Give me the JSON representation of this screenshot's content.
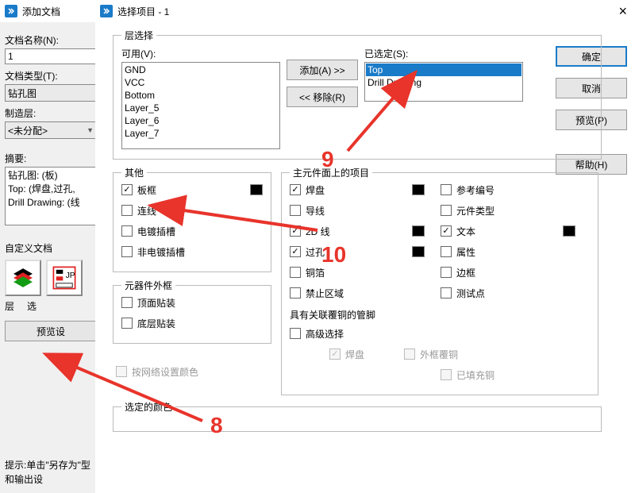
{
  "add_dialog": {
    "title": "添加文档",
    "doc_name_label": "文档名称(N):",
    "doc_name_value": "1",
    "doc_type_label": "文档类型(T):",
    "doc_type_value": "钻孔图",
    "mfg_layer_label": "制造层:",
    "mfg_layer_value": "<未分配>",
    "summary_label": "摘要:",
    "summary_lines": [
      "钻孔图: (板)",
      "Top: (焊盘,过孔,",
      "Drill Drawing: (线"
    ],
    "custom_doc_label": "自定义文档",
    "thumb1_label": "层",
    "thumb2_label": "选",
    "preview_btn": "预览设",
    "hint": "提示:单击\"另存为\"型和输出设"
  },
  "sel_dialog": {
    "title": "选择项目 - 1",
    "buttons": {
      "ok": "确定",
      "cancel": "取消",
      "preview": "预览(P)",
      "help": "帮助(H)"
    },
    "layer_group": "层选择",
    "available_label": "可用(V):",
    "available_items": [
      "GND",
      "VCC",
      "Bottom",
      "Layer_5",
      "Layer_6",
      "Layer_7"
    ],
    "selected_label": "已选定(S):",
    "selected_items": [
      "Top",
      "Drill Drawing"
    ],
    "add_btn": "添加(A) >>",
    "remove_btn": "<< 移除(R)",
    "other_group": "其他",
    "other_items": [
      {
        "label": "板框",
        "checked": true,
        "swatch": "#000"
      },
      {
        "label": "连线",
        "checked": false
      },
      {
        "label": "电镀插槽",
        "checked": false
      },
      {
        "label": "非电镀插槽",
        "checked": false
      }
    ],
    "outline_group": "元器件外框",
    "outline_items": [
      {
        "label": "顶面贴装",
        "checked": false
      },
      {
        "label": "底层贴装",
        "checked": false
      }
    ],
    "net_color_label": "按网络设置颜色",
    "main_group": "主元件面上的项目",
    "main_cols": {
      "left": [
        {
          "label": "焊盘",
          "checked": true,
          "swatch": "#000"
        },
        {
          "label": "导线",
          "checked": false
        },
        {
          "label": "2D 线",
          "checked": true,
          "swatch": "#000"
        },
        {
          "label": "过孔",
          "checked": true,
          "swatch": "#000"
        },
        {
          "label": "铜箔",
          "checked": false
        },
        {
          "label": "禁止区域",
          "checked": false
        }
      ],
      "right": [
        {
          "label": "参考编号",
          "checked": false
        },
        {
          "label": "元件类型",
          "checked": false
        },
        {
          "label": "文本",
          "checked": true,
          "swatch": "#000"
        },
        {
          "label": "属性",
          "checked": false
        },
        {
          "label": "边框",
          "checked": false
        },
        {
          "label": "测试点",
          "checked": false
        }
      ]
    },
    "assoc_group": "具有关联覆铜的管脚",
    "assoc_adv": "高级选择",
    "assoc_items": [
      {
        "label": "焊盘",
        "checked": true,
        "disabled": true
      },
      {
        "label": "外框覆铜",
        "checked": false,
        "disabled": true
      },
      {
        "label": "已填充铜",
        "checked": false,
        "disabled": true,
        "full": true
      }
    ],
    "selcolor_group": "选定的颜色"
  },
  "annotations": {
    "n8": "8",
    "n9": "9",
    "n10": "10"
  }
}
